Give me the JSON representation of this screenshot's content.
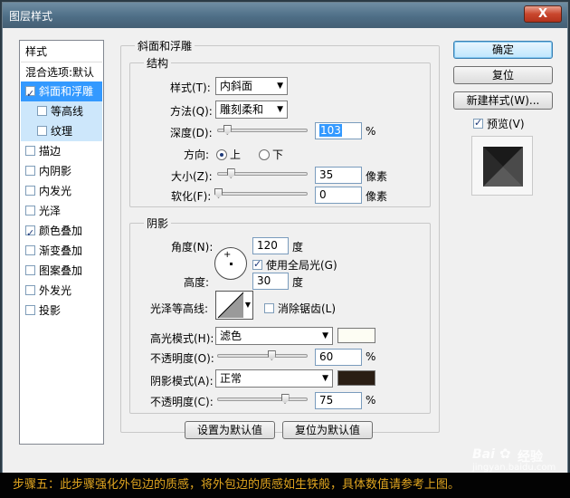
{
  "window": {
    "title": "图层样式",
    "close_label": "X"
  },
  "left_list": {
    "header": "样式",
    "blend": "混合选项:默认",
    "items": [
      {
        "label": "斜面和浮雕",
        "checked": true
      },
      {
        "label": "等高线",
        "checked": false
      },
      {
        "label": "纹理",
        "checked": false
      },
      {
        "label": "描边",
        "checked": false
      },
      {
        "label": "内阴影",
        "checked": false
      },
      {
        "label": "内发光",
        "checked": false
      },
      {
        "label": "光泽",
        "checked": false
      },
      {
        "label": "颜色叠加",
        "checked": true
      },
      {
        "label": "渐变叠加",
        "checked": false
      },
      {
        "label": "图案叠加",
        "checked": false
      },
      {
        "label": "外发光",
        "checked": false
      },
      {
        "label": "投影",
        "checked": false
      }
    ]
  },
  "bevel": {
    "group_title": "斜面和浮雕",
    "structure_title": "结构",
    "style_label": "样式(T):",
    "style_value": "内斜面",
    "technique_label": "方法(Q):",
    "technique_value": "雕刻柔和",
    "depth_label": "深度(D):",
    "depth_value": "103",
    "depth_unit": "%",
    "depth_fraction": 0.1,
    "direction_label": "方向:",
    "direction_up": "上",
    "direction_down": "下",
    "size_label": "大小(Z):",
    "size_value": "35",
    "size_unit": "像素",
    "size_fraction": 0.14,
    "soften_label": "软化(F):",
    "soften_value": "0",
    "soften_unit": "像素",
    "soften_fraction": 0.0
  },
  "shading": {
    "group_title": "阴影",
    "angle_label": "角度(N):",
    "angle_value": "120",
    "angle_unit": "度",
    "global_light_label": "使用全局光(G)",
    "global_light_checked": true,
    "altitude_label": "高度:",
    "altitude_value": "30",
    "altitude_unit": "度",
    "gloss_contour_label": "光泽等高线:",
    "anti_aliased_label": "消除锯齿(L)",
    "highlight_mode_label": "高光模式(H):",
    "highlight_mode_value": "滤色",
    "highlight_color": "#fdfdf3",
    "highlight_opacity_label": "不透明度(O):",
    "highlight_opacity_value": "60",
    "highlight_opacity_unit": "%",
    "highlight_opacity_fraction": 0.6,
    "shadow_mode_label": "阴影模式(A):",
    "shadow_mode_value": "正常",
    "shadow_color": "#2a1e14",
    "shadow_opacity_label": "不透明度(C):",
    "shadow_opacity_value": "75",
    "shadow_opacity_unit": "%",
    "shadow_opacity_fraction": 0.75
  },
  "bottom_buttons": {
    "make_default": "设置为默认值",
    "reset_default": "复位为默认值"
  },
  "right_panel": {
    "ok": "确定",
    "reset": "复位",
    "new_style": "新建样式(W)...",
    "preview_label": "预览(V)",
    "preview_checked": true
  },
  "caption": "步骤五：此步骤强化外包边的质感，将外包边的质感如生铁般，具体数值请参考上图。",
  "watermark": {
    "brand": "Bai",
    "word": "经验",
    "url": "jingyan.baidu.com"
  }
}
